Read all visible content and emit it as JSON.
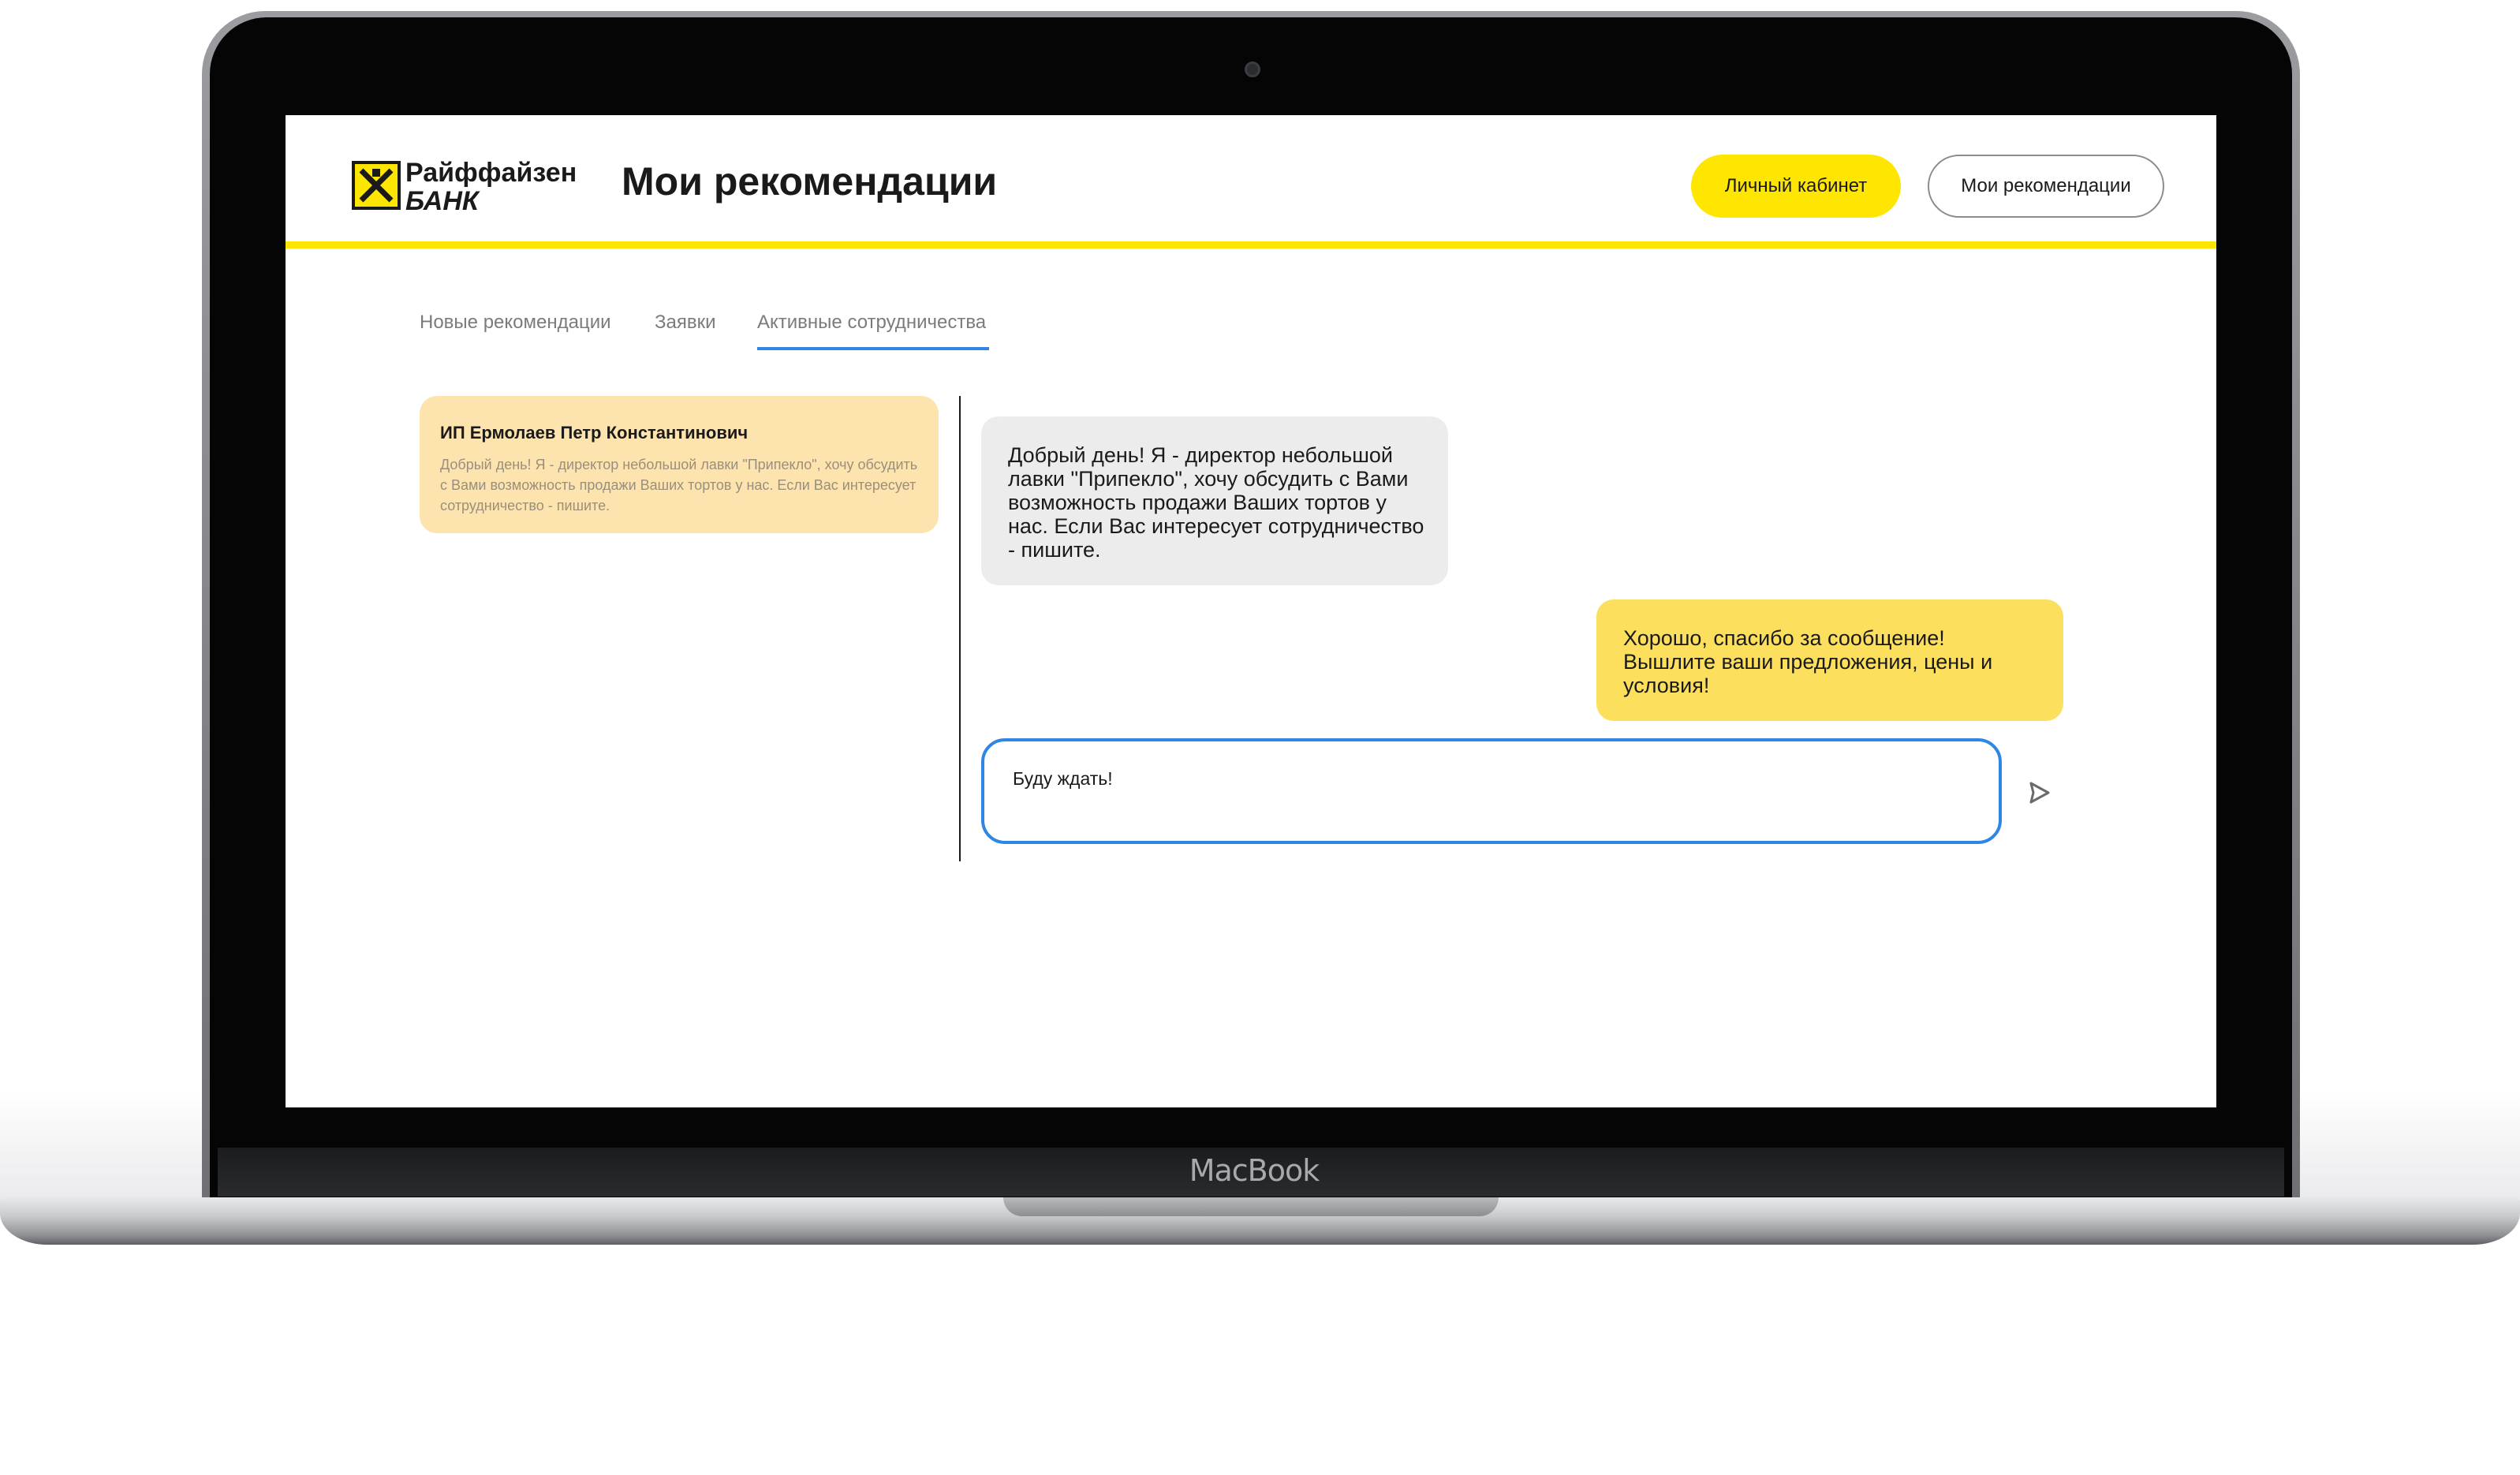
{
  "device": {
    "brand_label": "MacBook"
  },
  "header": {
    "logo_name": "Райффайзен",
    "logo_sub": "БАНК",
    "logo_icon": "raiffeisen-crossed-gables-icon",
    "page_title": "Мои рекомендации",
    "cabinet_label": "Личный кабинет",
    "recommendations_label": "Мои рекомендации",
    "accent_color": "#fee600"
  },
  "tabs": [
    {
      "label": "Новые рекомендации",
      "active": false
    },
    {
      "label": "Заявки",
      "active": false
    },
    {
      "label": "Активные сотрудничества",
      "active": true
    }
  ],
  "conversations": [
    {
      "name": "ИП Ермолаев Петр Константинович",
      "preview": "Добрый день! Я - директор небольшой лавки \"Припекло\", хочу обсудить с Вами возможность продажи Ваших тортов у нас. Если Вас интересует сотрудничество - пишите.",
      "selected": true
    }
  ],
  "messages": [
    {
      "direction": "incoming",
      "text": "Добрый день! Я - директор небольшой лавки \"Припекло\", хочу обсудить с Вами возможность продажи Ваших тортов у нас. Если Вас интересует сотрудничество - пишите."
    },
    {
      "direction": "outgoing",
      "text": "Хорошо, спасибо за сообщение! Вышлите ваши предложения, цены и условия!"
    }
  ],
  "composer": {
    "value": "Буду ждать!",
    "send_icon": "send-arrow-icon"
  }
}
